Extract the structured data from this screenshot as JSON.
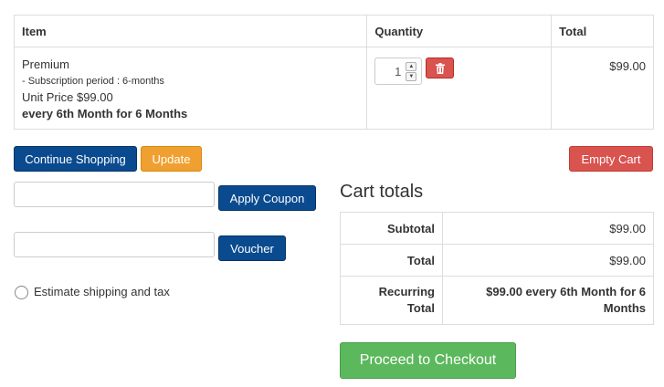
{
  "cart": {
    "headers": {
      "item": "Item",
      "quantity": "Quantity",
      "total": "Total"
    },
    "items": [
      {
        "name": "Premium",
        "subscription": "- Subscription period : 6-months",
        "unit_price": "Unit Price $99.00",
        "recurrence": "every 6th Month for 6 Months",
        "quantity": "1",
        "total": "$99.00"
      }
    ]
  },
  "actions": {
    "continue_shopping": "Continue Shopping",
    "update": "Update",
    "empty_cart": "Empty Cart"
  },
  "coupon": {
    "value": "",
    "button": "Apply Coupon"
  },
  "voucher": {
    "value": "",
    "button": "Voucher"
  },
  "shipping": {
    "label": "Estimate shipping and tax",
    "checked": false
  },
  "totals": {
    "title": "Cart totals",
    "subtotal_label": "Subtotal",
    "subtotal": "$99.00",
    "total_label": "Total",
    "total": "$99.00",
    "recurring_label_line1": "Recurring",
    "recurring_label_line2": "Total",
    "recurring_line1": "$99.00 every 6th Month for 6",
    "recurring_line2": "Months"
  },
  "checkout": {
    "label": "Proceed to Checkout"
  },
  "icons": {
    "delete": "trash-icon",
    "spin_up": "caret-up-icon",
    "spin_down": "caret-down-icon"
  },
  "colors": {
    "primary": "#0a4a8f",
    "warning": "#f0a030",
    "danger": "#d9534f",
    "success": "#5cb85c"
  }
}
